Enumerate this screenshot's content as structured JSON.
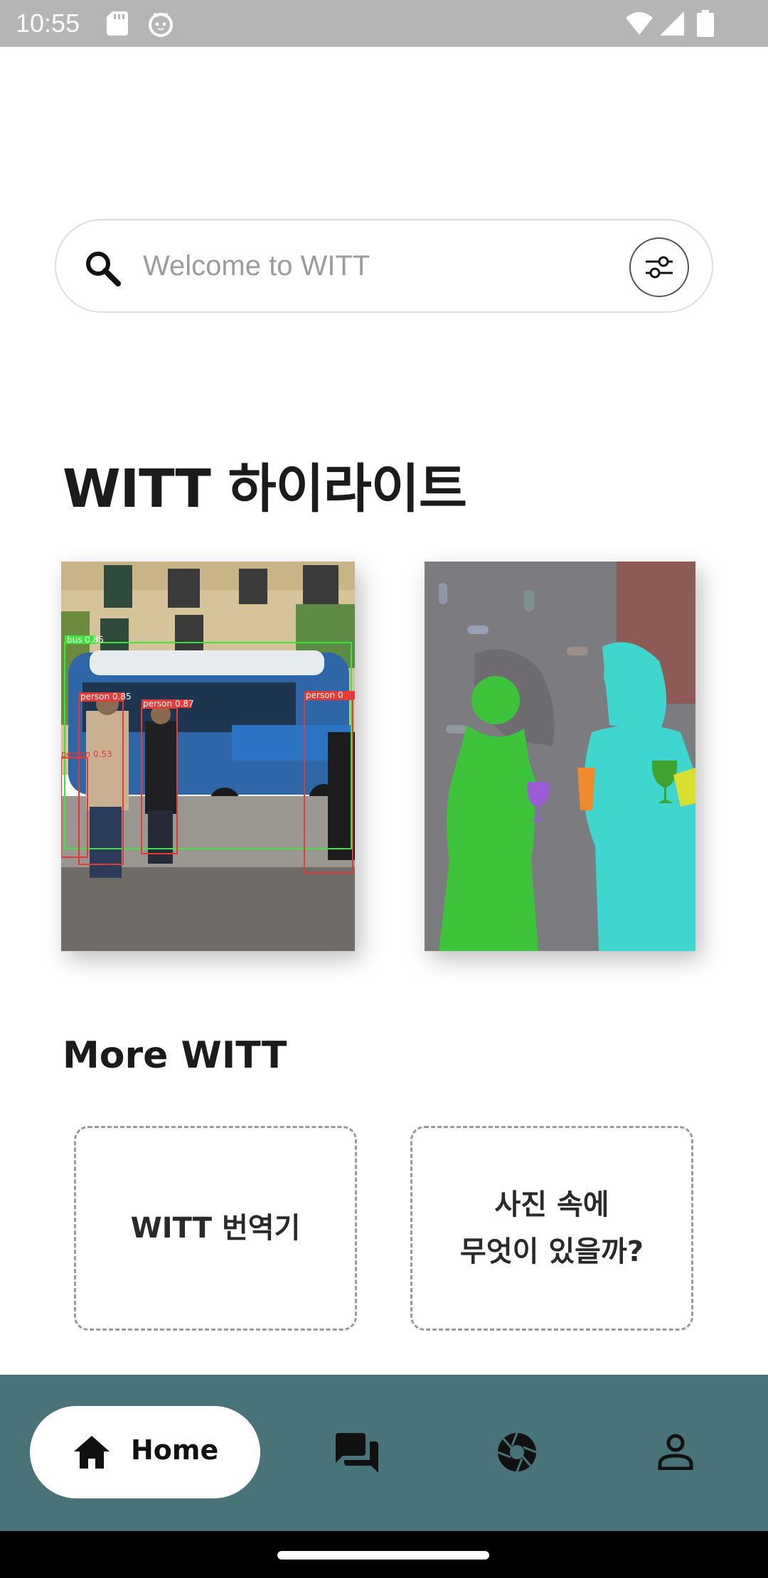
{
  "status_bar": {
    "time": "10:55",
    "icons": [
      "sd-card-icon",
      "cat-icon",
      "wifi-icon",
      "signal-icon",
      "battery-icon"
    ]
  },
  "search": {
    "placeholder": "Welcome to WITT",
    "icon": "search-icon",
    "filter_icon": "tune-icon"
  },
  "highlights": {
    "title": "WITT 하이라이트",
    "cards": [
      {
        "type": "object-detection",
        "labels": [
          "bus 0.85",
          "person 0.85",
          "person 0.87",
          "person 0.53",
          "person 0"
        ]
      },
      {
        "type": "segmentation"
      }
    ]
  },
  "more": {
    "title": "More WITT",
    "items": [
      {
        "label": "WITT 번역기"
      },
      {
        "label": "사진 속에\n무엇이 있을까?"
      }
    ]
  },
  "nav": {
    "home_label": "Home",
    "items": [
      "home-icon",
      "chat-icon",
      "camera-icon",
      "person-icon"
    ]
  },
  "colors": {
    "nav_bg": "#487378",
    "status_bar": "#b5b5b5",
    "detect_bus_box": "#3be63b",
    "detect_person_box": "#e53935",
    "seg_green": "#3ec43a",
    "seg_cyan": "#3fd6d0"
  }
}
